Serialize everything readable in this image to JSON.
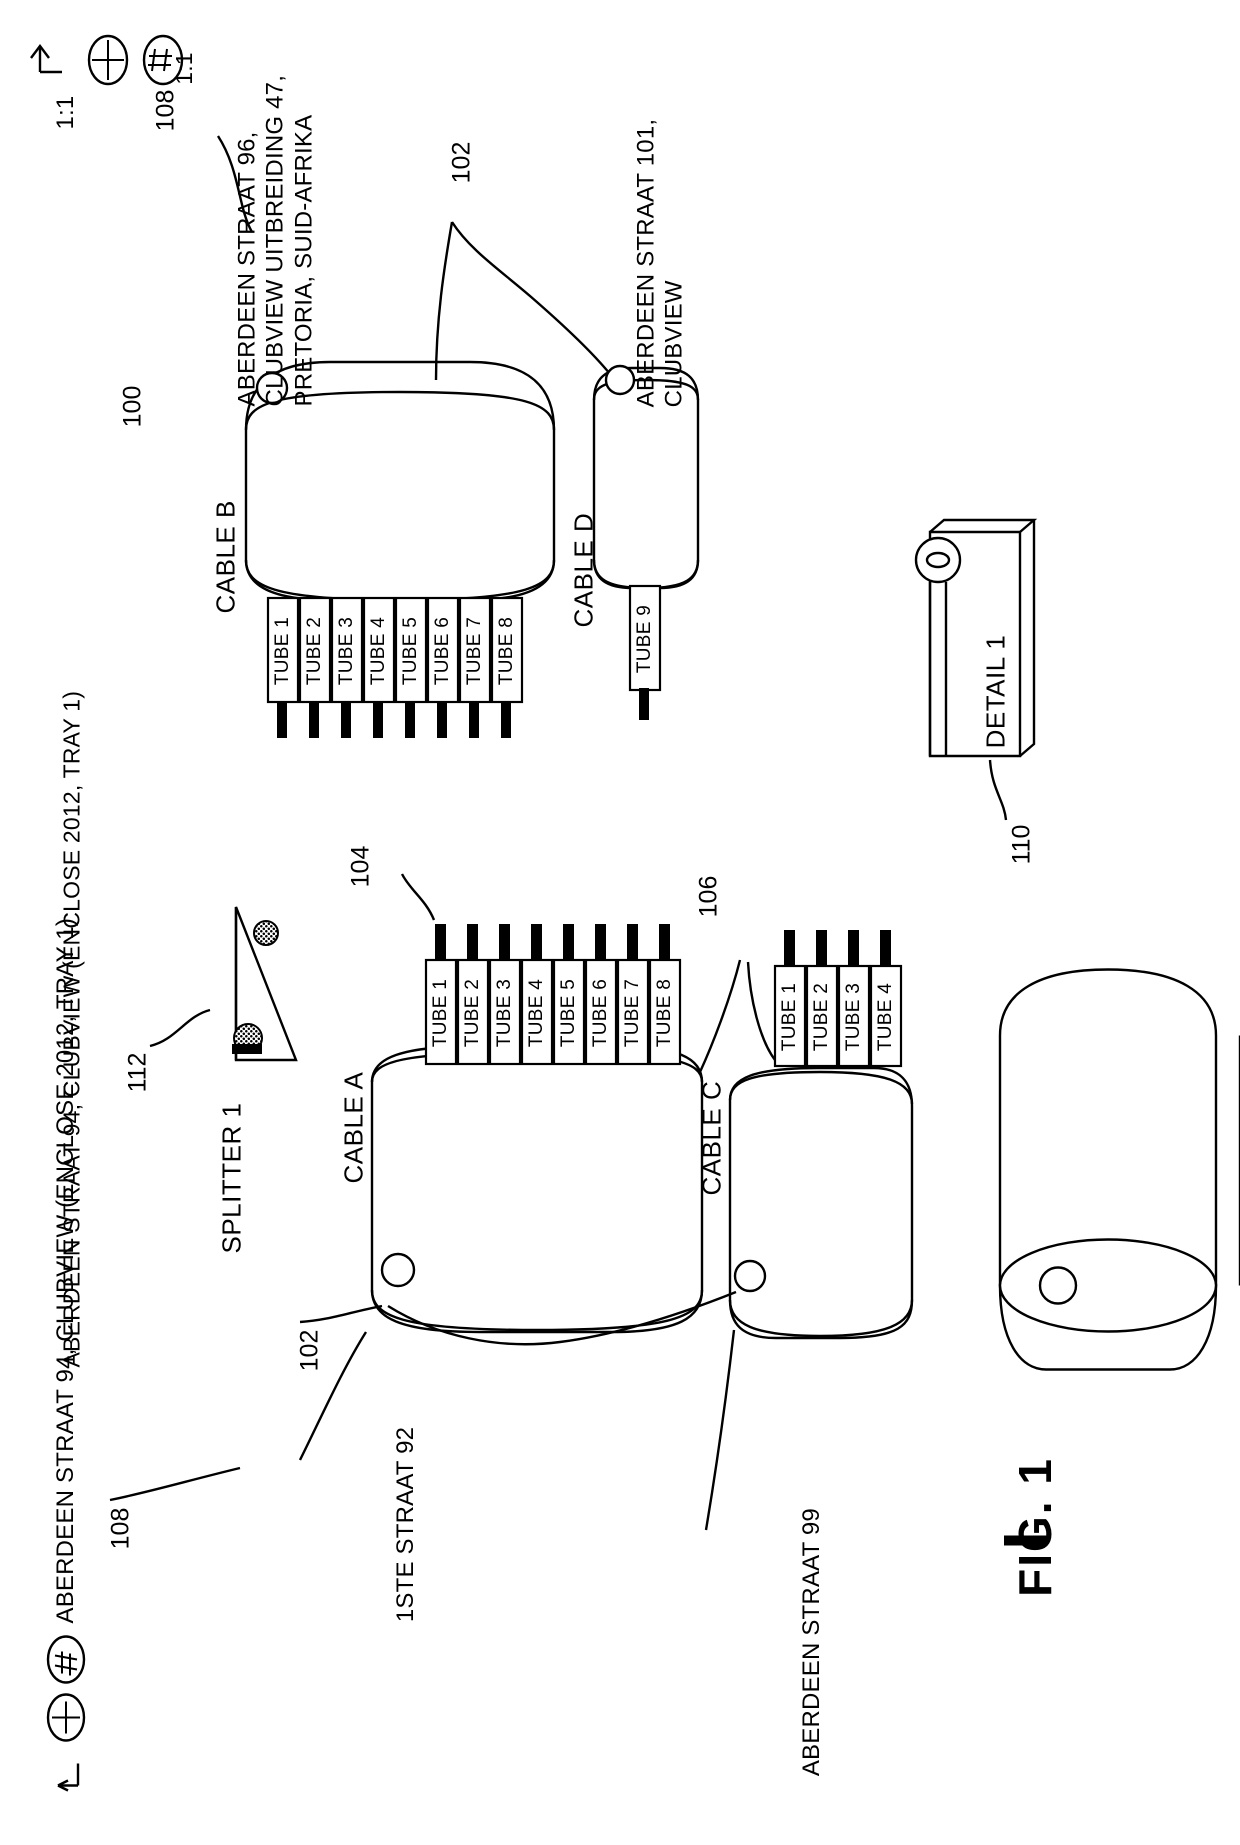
{
  "figure": {
    "label": "FIG. 1",
    "scale": "1:1",
    "header_title": "ABERDEEN STRAAT 94, CLUBVIEW (ENCLOSE 2012, TRAY 1)",
    "icons": [
      "north-arrow-icon",
      "crosshair-icon",
      "hash-circle-icon"
    ]
  },
  "reference_numerals": {
    "assembly": "100",
    "fiber_102_top": "102",
    "fiber_102_bottom": "102",
    "tubes_104": "104",
    "tubes_106": "106",
    "street_108_top": "108",
    "street_108_bottom": "108",
    "detail_110": "110",
    "splitter_112": "112"
  },
  "addresses": {
    "cable_b_address": "ABERDEEN STRAAT 96,\nCLUBVIEW UITBREIDING 47,\nPRETORIA, SUID-AFRIKA",
    "cable_d_address": "ABERDEEN STRAAT 101,\nCLUBVIEW",
    "cable_a_address": "1STE STRAAT 92",
    "cable_c_address": "ABERDEEN STRAAT 99"
  },
  "cables": [
    {
      "id": "cable-b",
      "label": "CABLE B",
      "tubes": [
        "TUBE 1",
        "TUBE 2",
        "TUBE 3",
        "TUBE 4",
        "TUBE 5",
        "TUBE 6",
        "TUBE 7",
        "TUBE 8"
      ]
    },
    {
      "id": "cable-d",
      "label": "CABLE D",
      "tubes": [
        "TUBE 9"
      ]
    },
    {
      "id": "cable-a",
      "label": "CABLE A",
      "tubes": [
        "TUBE 1",
        "TUBE 2",
        "TUBE 3",
        "TUBE 4",
        "TUBE 5",
        "TUBE 6",
        "TUBE 7",
        "TUBE 8"
      ]
    },
    {
      "id": "cable-c",
      "label": "CABLE C",
      "tubes": [
        "TUBE 1",
        "TUBE 2",
        "TUBE 3",
        "TUBE 4"
      ]
    }
  ],
  "splitter": {
    "label": "SPLITTER 1"
  },
  "detail": {
    "label": "DETAIL 1"
  },
  "colors": {
    "line": "#000000",
    "background": "#ffffff"
  }
}
